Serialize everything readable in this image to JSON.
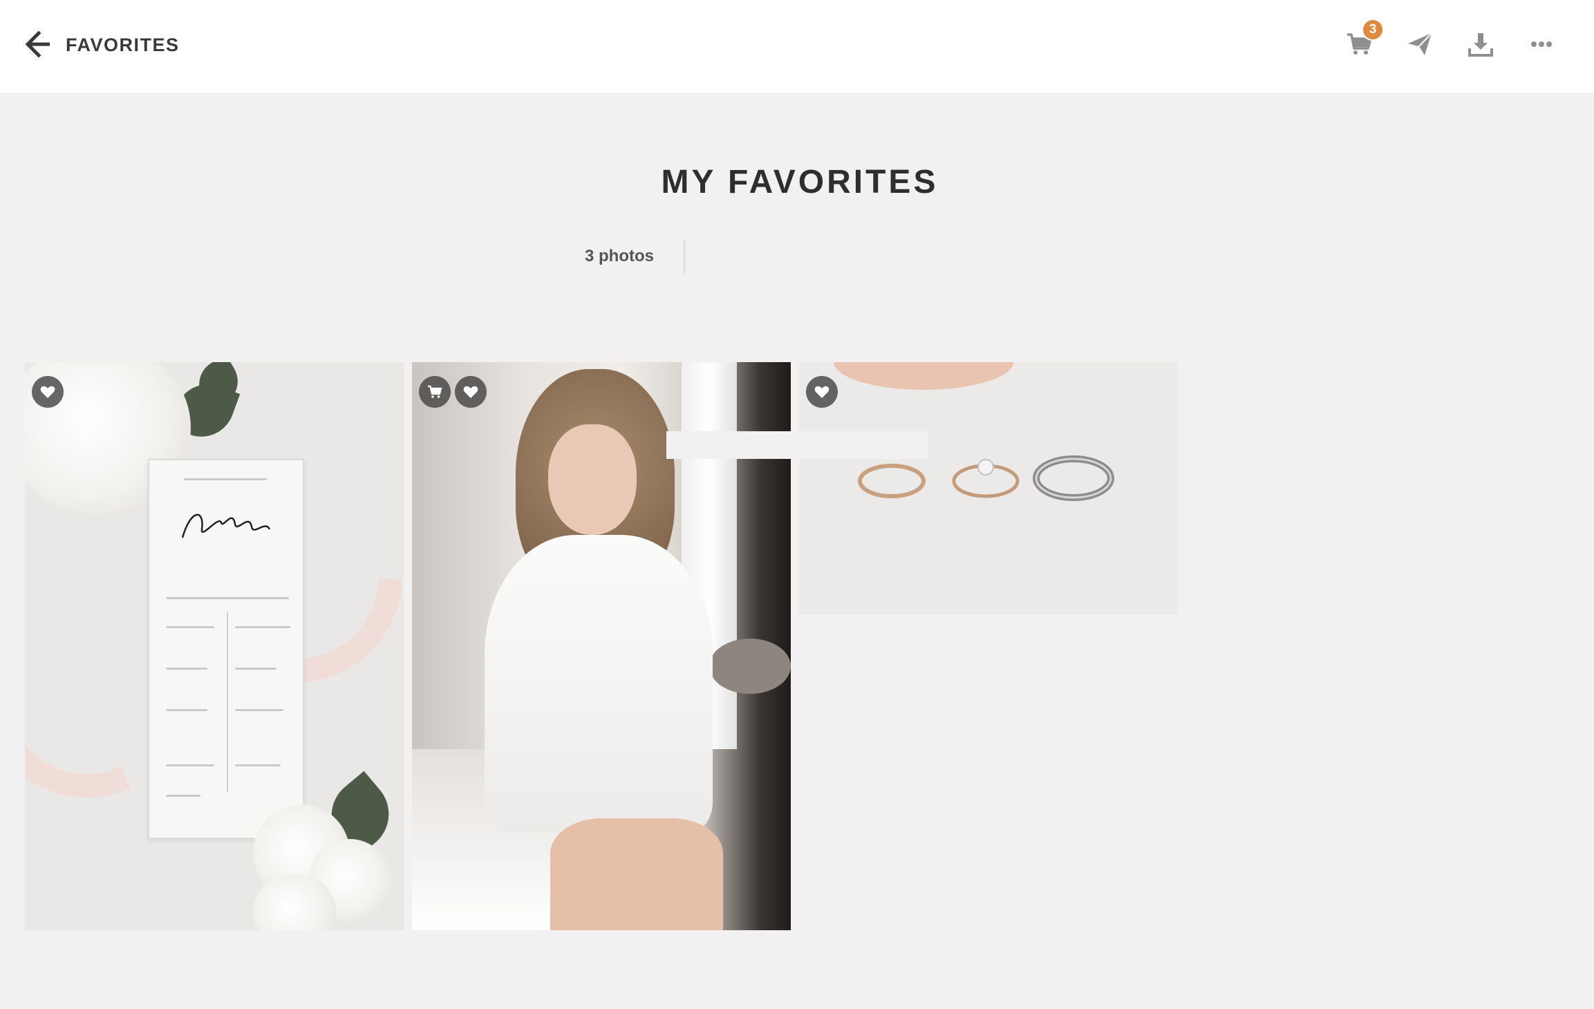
{
  "header": {
    "back_label": "",
    "title": "FAVORITES",
    "cart_count": "3"
  },
  "toolbar": {
    "icons": [
      "cart-icon",
      "send-icon",
      "download-icon",
      "more-icon"
    ]
  },
  "main": {
    "title": "MY FAVORITES",
    "photo_count_label": "3 photos"
  },
  "photos": [
    {
      "name": "wedding-program",
      "buttons": [
        "heart-icon"
      ]
    },
    {
      "name": "bride-getting-ready",
      "buttons": [
        "cart-icon",
        "heart-icon"
      ]
    },
    {
      "name": "wedding-rings",
      "buttons": [
        "heart-icon"
      ]
    }
  ],
  "colors": {
    "accent_badge": "#e0883b",
    "background": "#f2f0f0",
    "header": "#ffffff"
  }
}
